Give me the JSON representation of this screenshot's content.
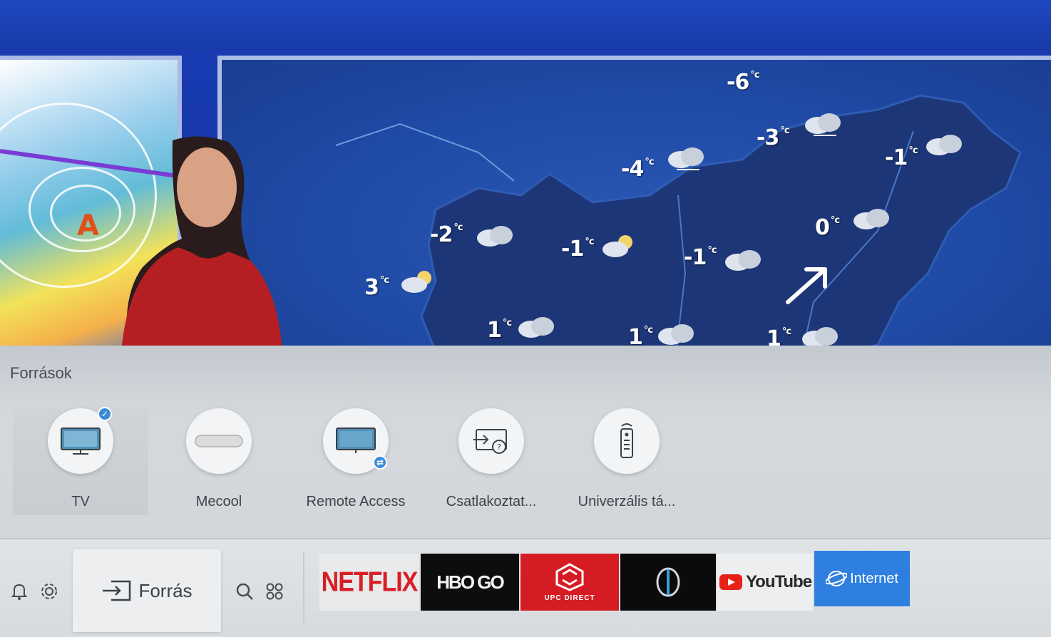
{
  "broadcast": {
    "temperatures": [
      {
        "value": "-6",
        "unit": "°c"
      },
      {
        "value": "-3",
        "unit": "°c"
      },
      {
        "value": "-1",
        "unit": "°c"
      },
      {
        "value": "-4",
        "unit": "°c"
      },
      {
        "value": "0",
        "unit": "°c"
      },
      {
        "value": "-2",
        "unit": "°c"
      },
      {
        "value": "-1",
        "unit": "°c"
      },
      {
        "value": "-1",
        "unit": "°c"
      },
      {
        "value": "3",
        "unit": "°c"
      },
      {
        "value": "1",
        "unit": "°c"
      },
      {
        "value": "1",
        "unit": "°c"
      },
      {
        "value": "1",
        "unit": "°c"
      }
    ],
    "pressure_label": "A"
  },
  "sources": {
    "title": "Források",
    "items": [
      {
        "label": "TV",
        "icon": "tv-icon",
        "selected": true
      },
      {
        "label": "Mecool",
        "icon": "set-top-box-icon",
        "selected": false
      },
      {
        "label": "Remote Access",
        "icon": "remote-access-icon",
        "selected": false
      },
      {
        "label": "Csatlakoztat...",
        "icon": "connection-guide-icon",
        "selected": false
      },
      {
        "label": "Univerzális tá...",
        "icon": "universal-remote-icon",
        "selected": false
      }
    ]
  },
  "hub": {
    "source_button_label": "Forrás",
    "apps": {
      "netflix": "NETFLIX",
      "hbogo": "HBO GO",
      "upc": "UPC DIRECT",
      "youtube": "YouTube",
      "internet": "Internet"
    }
  },
  "colors": {
    "accent": "#3a8bd8",
    "netflix": "#d81f26",
    "upc": "#d51c24",
    "internet": "#2e7fe0",
    "youtube": "#e62117"
  }
}
